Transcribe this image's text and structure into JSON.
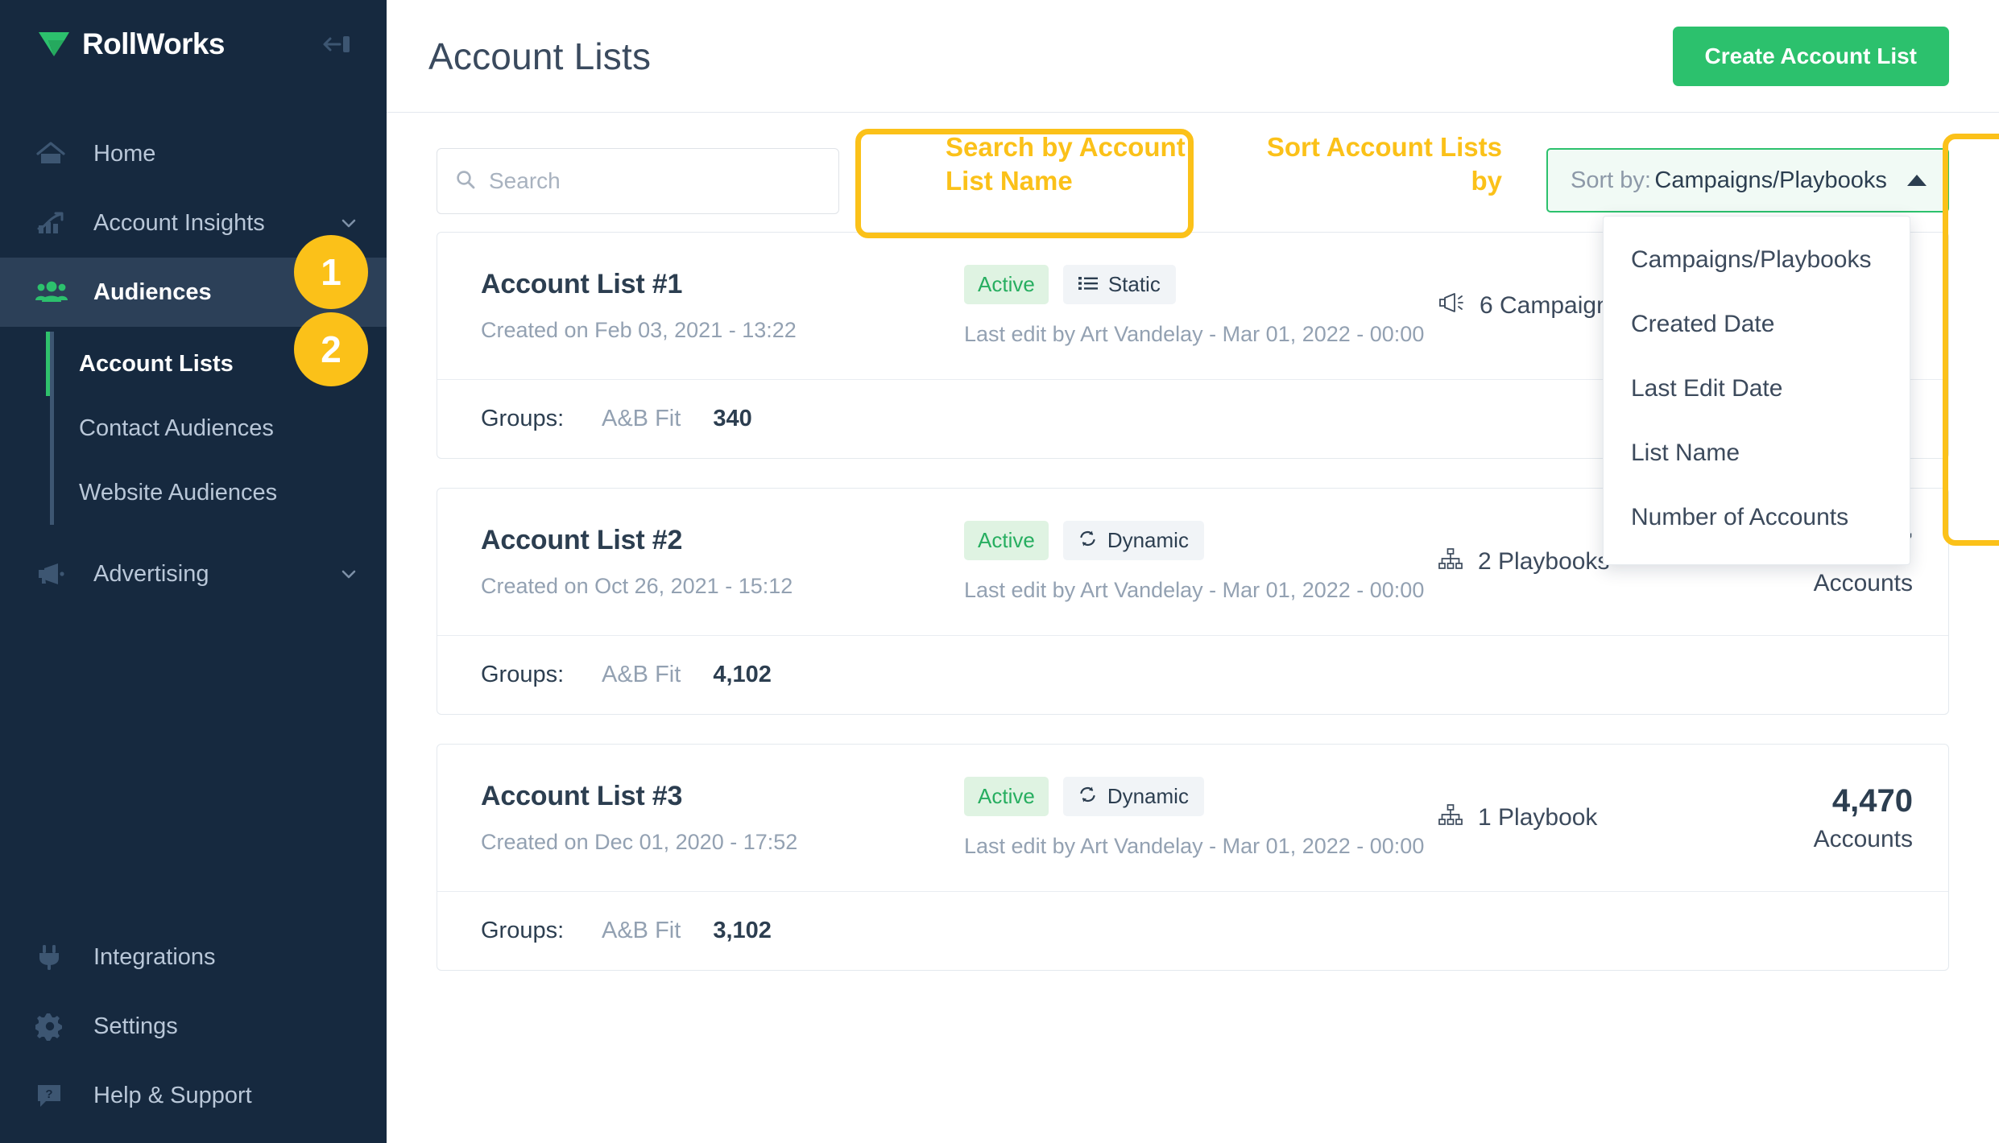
{
  "sidebar": {
    "brand": "RollWorks",
    "collapse_icon": "collapse-arrow-icon",
    "nav": [
      {
        "label": "Home",
        "icon": "home-icon",
        "active": false,
        "chevron": false
      },
      {
        "label": "Account Insights",
        "icon": "chart-trend-icon",
        "active": false,
        "chevron": true
      },
      {
        "label": "Audiences",
        "icon": "people-icon",
        "active": true,
        "chevron": false
      }
    ],
    "subnav": [
      {
        "label": "Account Lists",
        "active": true
      },
      {
        "label": "Contact Audiences",
        "active": false
      },
      {
        "label": "Website Audiences",
        "active": false
      }
    ],
    "nav_after": [
      {
        "label": "Advertising",
        "icon": "megaphone-icon",
        "active": false,
        "chevron": true
      }
    ],
    "bottom_nav": [
      {
        "label": "Integrations",
        "icon": "plug-icon"
      },
      {
        "label": "Settings",
        "icon": "gear-icon"
      },
      {
        "label": "Help & Support",
        "icon": "help-chat-icon"
      }
    ],
    "badges": [
      {
        "number": "1"
      },
      {
        "number": "2"
      }
    ]
  },
  "header": {
    "title": "Account Lists",
    "create_button": "Create Account List"
  },
  "toolbar": {
    "search_placeholder": "Search",
    "search_value": "",
    "search_icon": "search-icon",
    "annotation_search": "Search by Account List Name",
    "annotation_sort": "Sort Account Lists by",
    "sort_label": "Sort by:",
    "sort_value": "Campaigns/Playbooks",
    "sort_caret_icon": "caret-up-icon",
    "sort_options": [
      "Campaigns/Playbooks",
      "Created Date",
      "Last Edit Date",
      "List Name",
      "Number of Accounts"
    ]
  },
  "groups_label": "Groups:",
  "accounts_label": "Accounts",
  "lists": [
    {
      "name": "Account List #1",
      "created": "Created on Feb 03, 2021 - 13:22",
      "status": "Active",
      "type": "Static",
      "type_icon": "list-lines-icon",
      "last_edit": "Last edit by Art Vandelay - Mar 01, 2022 - 00:00",
      "relation_count": "6 Campaigns",
      "relation_icon": "megaphone-icon",
      "accounts": "",
      "groups": [
        {
          "name": "A&B Fit",
          "value": "340"
        }
      ]
    },
    {
      "name": "Account List #2",
      "created": "Created on Oct 26, 2021 - 15:12",
      "status": "Active",
      "type": "Dynamic",
      "type_icon": "refresh-icon",
      "last_edit": "Last edit by Art Vandelay - Mar 01, 2022 - 00:00",
      "relation_count": "2 Playbooks",
      "relation_icon": "sitemap-icon",
      "accounts": "7,317",
      "groups": [
        {
          "name": "A&B Fit",
          "value": "4,102"
        }
      ]
    },
    {
      "name": "Account List #3",
      "created": "Created on Dec 01, 2020 - 17:52",
      "status": "Active",
      "type": "Dynamic",
      "type_icon": "refresh-icon",
      "last_edit": "Last edit by Art Vandelay - Mar 01, 2022 - 00:00",
      "relation_count": "1 Playbook",
      "relation_icon": "sitemap-icon",
      "accounts": "4,470",
      "groups": [
        {
          "name": "A&B Fit",
          "value": "3,102"
        }
      ]
    }
  ],
  "colors": {
    "sidebar_bg": "#16293f",
    "sidebar_active": "#2c4058",
    "brand_green": "#2cc16d",
    "annotation_yellow": "#fbc119",
    "badge_active_bg": "#dff3e2",
    "badge_active_text": "#27ae60",
    "text_dark": "#2c3e50",
    "text_muted": "#93a1b2"
  }
}
